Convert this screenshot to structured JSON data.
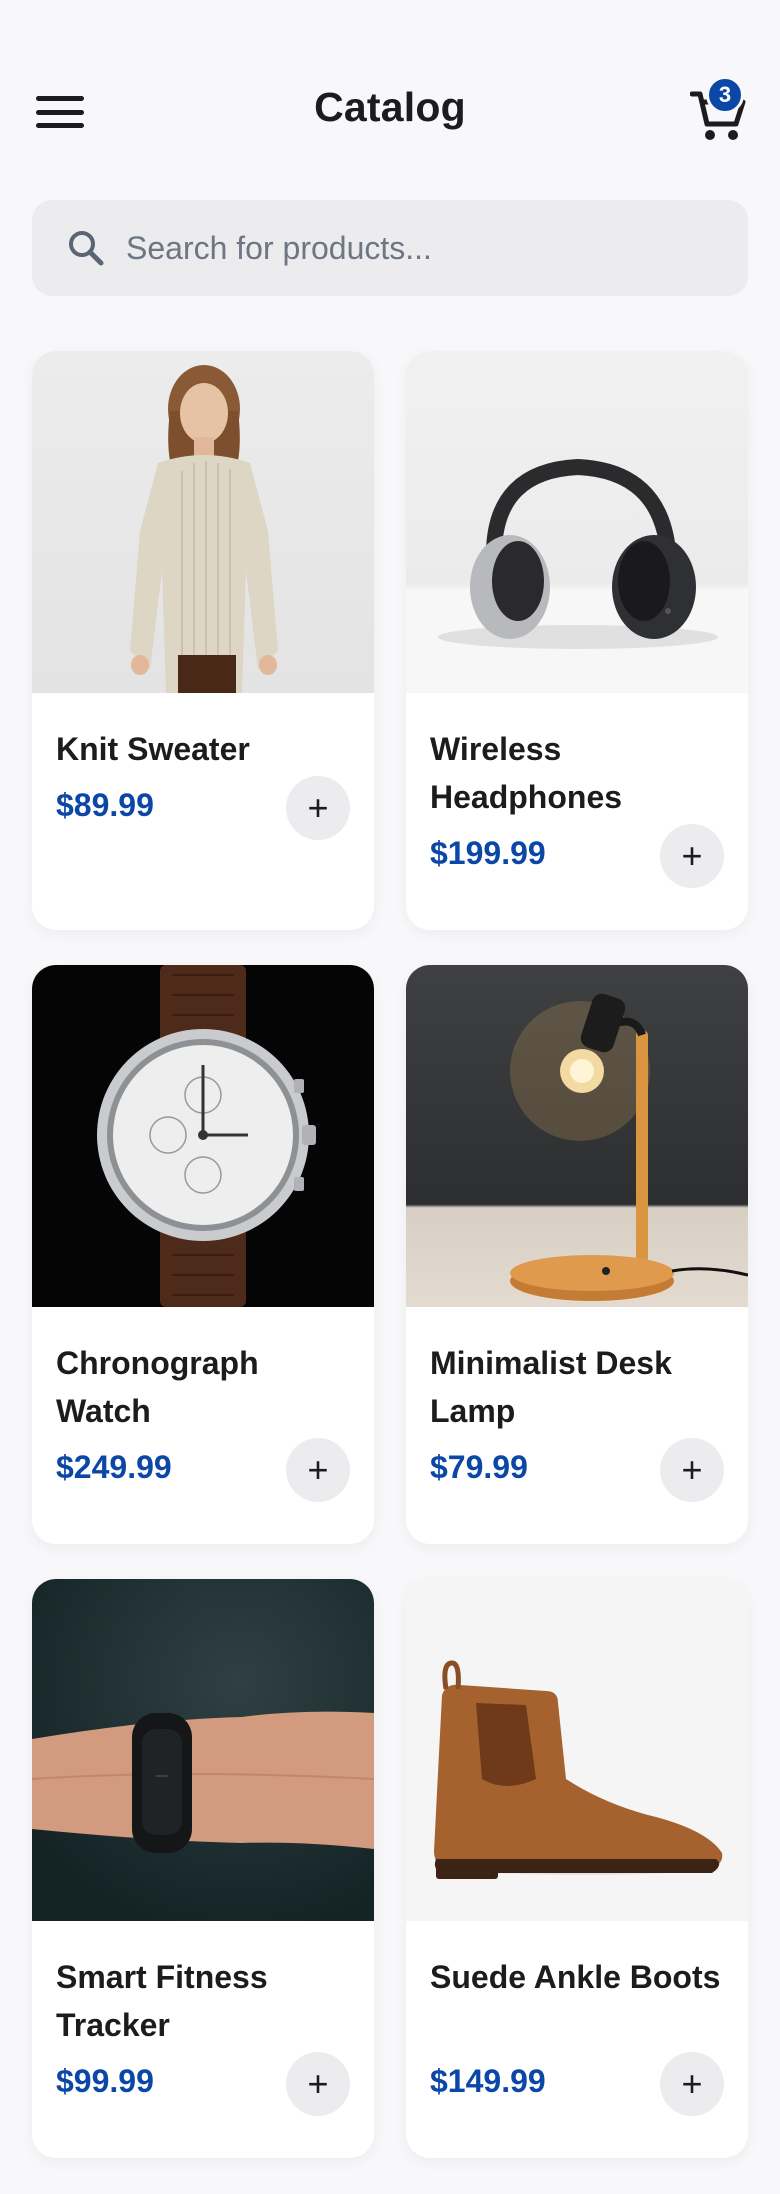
{
  "header": {
    "title": "Catalog",
    "cart_count": "3"
  },
  "search": {
    "placeholder": "Search for products..."
  },
  "colors": {
    "accent": "#0b47a7",
    "background": "#f8f8fa",
    "button_bg": "#ececef"
  },
  "products": [
    {
      "name": "Knit Sweater",
      "price": "$89.99",
      "add_label": "+",
      "image": "sweater"
    },
    {
      "name": "Wireless Headphones",
      "price": "$199.99",
      "add_label": "+",
      "image": "headphones"
    },
    {
      "name": "Chronograph Watch",
      "price": "$249.99",
      "add_label": "+",
      "image": "watch"
    },
    {
      "name": "Minimalist Desk Lamp",
      "price": "$79.99",
      "add_label": "+",
      "image": "lamp"
    },
    {
      "name": "Smart Fitness Tracker",
      "price": "$99.99",
      "add_label": "+",
      "image": "fitness-tracker"
    },
    {
      "name": "Suede Ankle Boots",
      "price": "$149.99",
      "add_label": "+",
      "image": "boots"
    }
  ]
}
